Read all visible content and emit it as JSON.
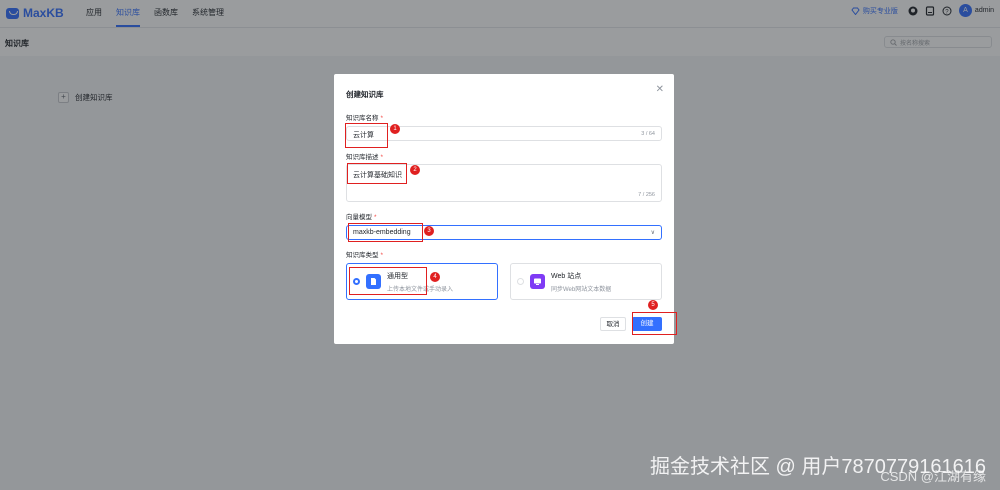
{
  "app": {
    "logo": "MaxKB",
    "nav": [
      {
        "label": "应用",
        "active": false
      },
      {
        "label": "知识库",
        "active": true
      },
      {
        "label": "函数库",
        "active": false
      },
      {
        "label": "系统管理",
        "active": false
      }
    ],
    "buy_label": "购买专业版",
    "user": {
      "name": "admin",
      "avatar_letter": "A"
    },
    "icons": [
      "diamond-icon",
      "github-icon",
      "book-icon",
      "help-icon"
    ]
  },
  "page": {
    "title": "知识库",
    "search_placeholder": "按名称搜索",
    "create_card_label": "创建知识库"
  },
  "dialog": {
    "title": "创建知识库",
    "name": {
      "label": "知识库名称",
      "required_mark": "*",
      "value": "云计算",
      "count": "3 / 64"
    },
    "desc": {
      "label": "知识库描述",
      "required_mark": "*",
      "value": "云计算基础知识",
      "count": "7 / 256"
    },
    "model": {
      "label": "向量模型",
      "required_mark": "*",
      "value": "maxkb-embedding"
    },
    "type": {
      "label": "知识库类型",
      "required_mark": "*",
      "options": [
        {
          "name": "通用型",
          "desc": "上传本地文件或手动录入",
          "selected": true,
          "icon": "file-icon",
          "color": "#3370ff"
        },
        {
          "name": "Web 站点",
          "desc": "同步Web网站文本数据",
          "selected": false,
          "icon": "web-icon",
          "color": "#7f3bf5"
        }
      ]
    },
    "cancel_label": "取消",
    "create_label": "创建"
  },
  "annotations": {
    "badges": [
      "1",
      "2",
      "3",
      "4",
      "5"
    ],
    "color": "#e02020"
  },
  "watermarks": {
    "line1": "掘金技术社区 @ 用户7870779161616",
    "line2": "CSDN @江湖有缘"
  },
  "colors": {
    "accent": "#3370ff",
    "required": "#f54a45",
    "annotation": "#e02020"
  }
}
